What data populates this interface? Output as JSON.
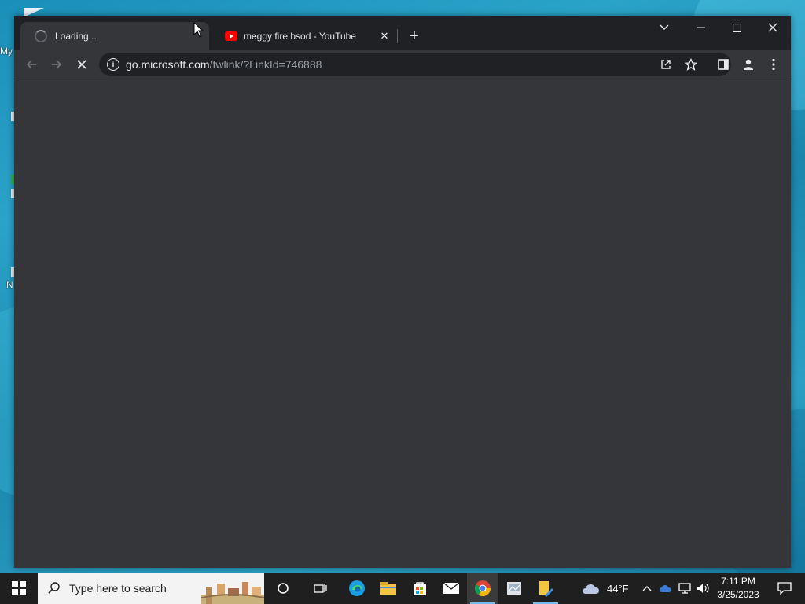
{
  "desktop": {
    "fragments": [
      "My",
      "N"
    ]
  },
  "browser": {
    "tabs": [
      {
        "title": "Loading...",
        "active": true,
        "icon": "loading-spinner"
      },
      {
        "title": "meggy fire bsod - YouTube",
        "active": false,
        "icon": "youtube-icon"
      }
    ],
    "new_tab_symbol": "+",
    "address": {
      "host": "go.microsoft.com",
      "path": "/fwlink/?LinkId=746888"
    }
  },
  "taskbar": {
    "search_placeholder": "Type here to search",
    "weather": {
      "temp": "44°F",
      "icon": "cloud-icon"
    },
    "clock": {
      "time": "7:11 PM",
      "date": "3/25/2023"
    },
    "pinned": [
      "task-view-icon",
      "edge-icon",
      "file-explorer-icon",
      "store-icon",
      "mail-icon",
      "chrome-icon",
      "app-icon",
      "notepad-icon"
    ]
  },
  "colors": {
    "titlebar": "#202124",
    "toolbar": "#35363a",
    "omnibox": "#202124",
    "taskbar": "#1f1f1f",
    "youtube_red": "#ff0000",
    "accent": "#76b9ed"
  }
}
